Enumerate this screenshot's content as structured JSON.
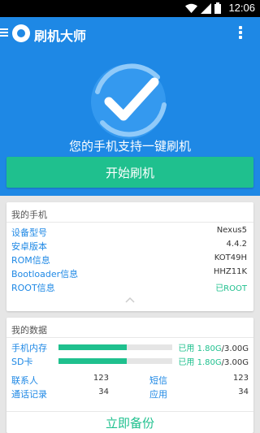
{
  "status_bar": {
    "time": "12:06",
    "icons": [
      "wifi-icon",
      "signal-icon",
      "battery-icon"
    ]
  },
  "app_bar": {
    "title": "刷机大师",
    "menu_icon": "hamburger-icon",
    "more_icon": "overflow-icon"
  },
  "hero": {
    "message": "您的手机支持一键刷机",
    "start_button": "开始刷机"
  },
  "my_phone": {
    "title": "我的手机",
    "rows": [
      {
        "label": "设备型号",
        "value": "Nexus5"
      },
      {
        "label": "安卓版本",
        "value": "4.4.2"
      },
      {
        "label": "ROM信息",
        "value": "KOT49H"
      },
      {
        "label": "Bootloader信息",
        "value": "HHZ11K"
      },
      {
        "label": "ROOT信息",
        "value": "已ROOT"
      }
    ]
  },
  "my_data": {
    "title": "我的数据",
    "storage": [
      {
        "label": "手机内存",
        "used_prefix": "已用 ",
        "used": "1.80G",
        "total": "/3.00G",
        "fraction": 0.6
      },
      {
        "label": "SD卡",
        "used_prefix": "已用 ",
        "used": "1.80G",
        "total": "/3.00G",
        "fraction": 0.6
      }
    ],
    "stats": [
      {
        "label": "联系人",
        "value": "123"
      },
      {
        "label": "短信",
        "value": "123"
      },
      {
        "label": "通话记录",
        "value": "34"
      },
      {
        "label": "应用",
        "value": "34"
      }
    ],
    "backup_button": "立即备份"
  },
  "colors": {
    "primary": "#1e88e5",
    "accent": "#1fc08e"
  }
}
